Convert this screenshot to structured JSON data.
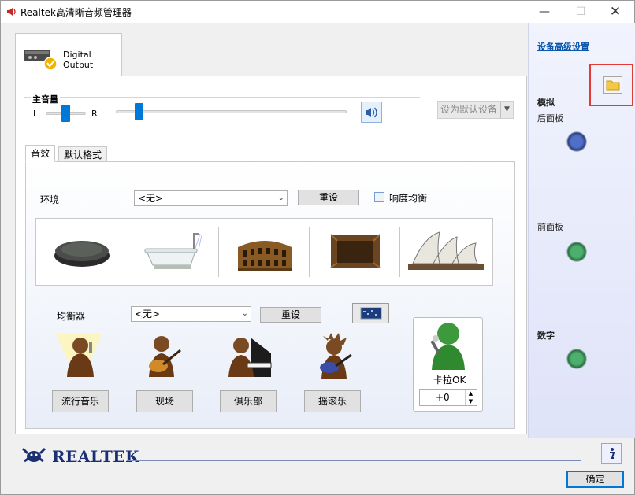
{
  "window": {
    "title": "Realtek高清晰音频管理器"
  },
  "device_tab": {
    "label": "Digital Output"
  },
  "volume": {
    "title": "主音量",
    "left_label": "L",
    "right_label": "R",
    "balance": 0.5,
    "level": 0.1
  },
  "default_device": {
    "label": "设为默认设备"
  },
  "tabs": [
    {
      "label": "音效"
    },
    {
      "label": "默认格式"
    }
  ],
  "environment": {
    "label": "环境",
    "value": "<无>",
    "reset_label": "重设",
    "loudness_label": "响度均衡",
    "loudness_checked": false,
    "items": [
      {
        "icon": "stone-disc-icon"
      },
      {
        "icon": "bathtub-icon"
      },
      {
        "icon": "colosseum-icon"
      },
      {
        "icon": "wooden-room-icon"
      },
      {
        "icon": "opera-house-icon"
      }
    ]
  },
  "equalizer": {
    "label": "均衡器",
    "value": "<无>",
    "reset_label": "重设",
    "presets": [
      {
        "label": "流行音乐",
        "icon": "pop-singer-icon"
      },
      {
        "label": "现场",
        "icon": "guitarist-icon"
      },
      {
        "label": "俱乐部",
        "icon": "pianist-icon"
      },
      {
        "label": "摇滚乐",
        "icon": "rocker-icon"
      }
    ]
  },
  "karaoke": {
    "label": "卡拉OK",
    "value": "+0"
  },
  "sidebar": {
    "advanced_link": "设备高级设置",
    "analog_label": "模拟",
    "rear_panel_label": "后面板",
    "front_panel_label": "前面板",
    "digital_label": "数字",
    "colors": {
      "rear_jack": "#4f6fc9",
      "front_jack": "#4caf6e",
      "digital_jack": "#4caf6e"
    }
  },
  "footer": {
    "brand": "REALTEK",
    "ok_label": "确定"
  }
}
